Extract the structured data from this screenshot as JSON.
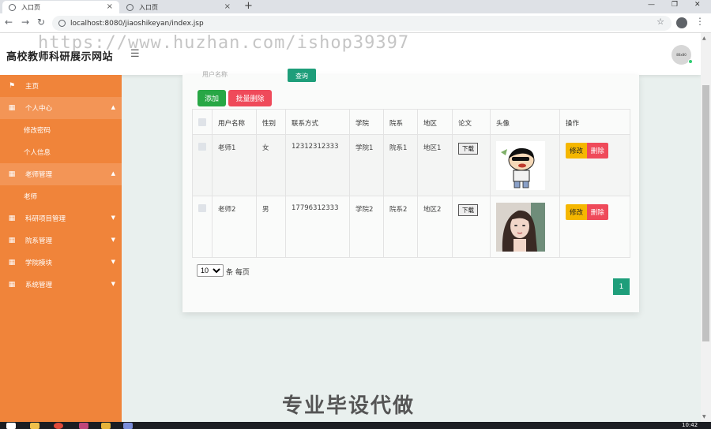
{
  "browser": {
    "tabs": [
      {
        "title": "入口页"
      },
      {
        "title": "入口页"
      }
    ],
    "url": "localhost:8080/jiaoshikeyan/index.jsp"
  },
  "header": {
    "site_title": "高校教师科研展示网站",
    "watermark": "https://www.huzhan.com/ishop39397",
    "avatar_text": "80x80"
  },
  "sidebar": {
    "items": [
      {
        "label": "主页",
        "icon": "flag-icon"
      },
      {
        "label": "个人中心",
        "icon": "grid-icon"
      },
      {
        "label": "修改密码"
      },
      {
        "label": "个人信息"
      },
      {
        "label": "老师管理",
        "icon": "grid-icon"
      },
      {
        "label": "老师"
      },
      {
        "label": "科研项目管理",
        "icon": "grid-icon"
      },
      {
        "label": "院系管理",
        "icon": "grid-icon"
      },
      {
        "label": "学院模块",
        "icon": "grid-icon"
      },
      {
        "label": "系统管理",
        "icon": "grid-icon"
      }
    ]
  },
  "search": {
    "placeholder": "用户名称",
    "button": "查询"
  },
  "toolbar": {
    "add": "添加",
    "batch_delete": "批量删除"
  },
  "table": {
    "headers": [
      "用户名称",
      "性别",
      "联系方式",
      "学院",
      "院系",
      "地区",
      "论文",
      "头像",
      "操作"
    ],
    "rows": [
      {
        "name": "老师1",
        "gender": "女",
        "phone": "12312312333",
        "college": "学院1",
        "dept": "院系1",
        "region": "地区1",
        "paper": "下载"
      },
      {
        "name": "老师2",
        "gender": "男",
        "phone": "17796312333",
        "college": "学院2",
        "dept": "院系2",
        "region": "地区2",
        "paper": "下载"
      }
    ],
    "edit_label": "修改",
    "delete_label": "删除"
  },
  "pagination": {
    "page_size": "10",
    "page_size_label": "条 每页",
    "current_page": "1"
  },
  "overlay": "专业毕设代做",
  "taskbar": {
    "clock": "10:42"
  }
}
